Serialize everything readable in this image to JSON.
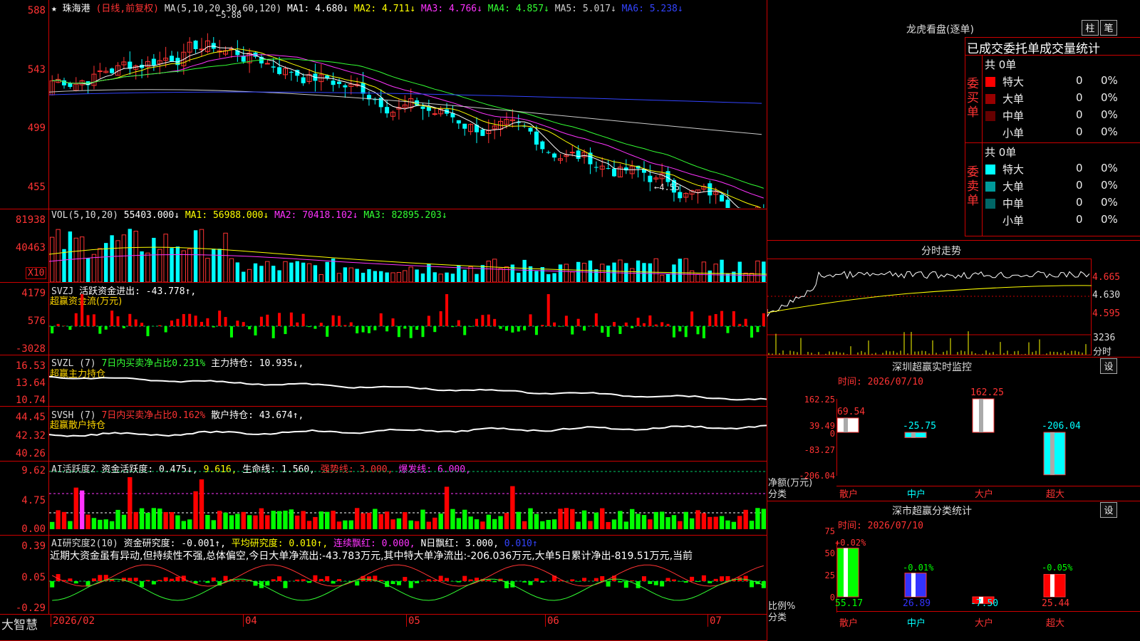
{
  "app_name": "大智慧",
  "main": {
    "star": "★",
    "stock": "珠海港",
    "mode": "(日线,前复权)",
    "ma_legend": [
      {
        "text": "MA(5,10,20,30,60,120)",
        "color": "#dddddd"
      },
      {
        "text": "MA1: 4.680↓",
        "color": "#ffffff"
      },
      {
        "text": "MA2: 4.711↓",
        "color": "#ffff00"
      },
      {
        "text": "MA3: 4.766↓",
        "color": "#ff33ff"
      },
      {
        "text": "MA4: 4.857↓",
        "color": "#33ff33"
      },
      {
        "text": "MA5: 5.017↓",
        "color": "#cccccc"
      },
      {
        "text": "MA6: 5.238↓",
        "color": "#3344ff"
      }
    ],
    "y_ticks": [
      "588",
      "543",
      "499",
      "455"
    ],
    "high_mark": "←5.88",
    "low_mark": "←4.55"
  },
  "vol": {
    "legend": [
      {
        "text": "VOL(5,10,20)",
        "color": "#dddddd"
      },
      {
        "text": "55403.000↓",
        "color": "#ffffff"
      },
      {
        "text": "MA1: 56988.000↓",
        "color": "#ffff00"
      },
      {
        "text": "MA2: 70418.102↓",
        "color": "#ff33ff"
      },
      {
        "text": "MA3: 82895.203↓",
        "color": "#33ff33"
      }
    ],
    "y_ticks": [
      "81938",
      "40463"
    ],
    "unit": "X10"
  },
  "svzj": {
    "legend": [
      {
        "text": "SVZJ",
        "color": "#dddddd"
      },
      {
        "text": "活跃资金进出: -43.778↑,",
        "color": "#ffffff"
      }
    ],
    "subtitle": "超赢资金流(万元)",
    "y_ticks": [
      "4179",
      "576",
      "-3028"
    ]
  },
  "svzl": {
    "legend": [
      {
        "text": "SVZL (7)",
        "color": "#dddddd"
      },
      {
        "text": "7日内买卖净占比0.231%",
        "color": "#33ff33"
      },
      {
        "text": "主力持仓: 10.935↓,",
        "color": "#ffffff"
      }
    ],
    "subtitle": "超赢主力持仓",
    "y_ticks": [
      "16.53",
      "13.64",
      "10.74"
    ]
  },
  "svsh": {
    "legend": [
      {
        "text": "SVSH (7)",
        "color": "#dddddd"
      },
      {
        "text": "7日内买卖净占比0.162%",
        "color": "#ff3333"
      },
      {
        "text": "散户持仓: 43.674↑,",
        "color": "#ffffff"
      }
    ],
    "subtitle": "超赢散户持仓",
    "y_ticks": [
      "44.45",
      "42.32",
      "40.26"
    ]
  },
  "ai_active": {
    "legend": [
      {
        "text": "AI活跃度2",
        "color": "#dddddd"
      },
      {
        "text": "资金活跃度: 0.475↓,",
        "color": "#ffffff"
      },
      {
        "text": "9.616,",
        "color": "#ffff00"
      },
      {
        "text": "生命线: 1.560,",
        "color": "#ffffff"
      },
      {
        "text": "强势线: 3.000,",
        "color": "#ff3333"
      },
      {
        "text": "爆发线: 6.000,",
        "color": "#ff33ff"
      }
    ],
    "y_ticks": [
      "9.62",
      "4.75",
      "0.00"
    ]
  },
  "ai_research": {
    "legend": [
      {
        "text": "AI研究度2(10)",
        "color": "#dddddd"
      },
      {
        "text": "资金研究度: -0.001↑,",
        "color": "#ffffff"
      },
      {
        "text": "平均研究度: 0.010↑,",
        "color": "#ffff00"
      },
      {
        "text": "连续飘红: 0.000,",
        "color": "#ff33ff"
      },
      {
        "text": "N日飘红: 3.000,",
        "color": "#ffffff"
      },
      {
        "text": "0.010↑",
        "color": "#3344ff"
      }
    ],
    "commentary": "近期大资金虽有异动,但持续性不强,总体偏空,今日大单净流出:-43.783万元,其中特大单净流出:-206.036万元,大单5日累计净出-819.51万元,当前",
    "y_ticks": [
      "0.39",
      "0.05",
      "-0.29"
    ]
  },
  "x_axis": [
    "2026/02",
    "04",
    "05",
    "06",
    "07"
  ],
  "dragon": {
    "title": "龙虎看盘(逐单)",
    "btn_bar": "柱",
    "btn_line": "笔",
    "header": "已成交委托单成交量统计",
    "buy_label": "委买单",
    "sell_label": "委卖单",
    "buy_total": "共 0单",
    "sell_total": "共 0单",
    "buy_rows": [
      {
        "name": "特大",
        "qty": "0",
        "pct": "0%",
        "color": "#ff0000"
      },
      {
        "name": "大单",
        "qty": "0",
        "pct": "0%",
        "color": "#990000"
      },
      {
        "name": "中单",
        "qty": "0",
        "pct": "0%",
        "color": "#660000"
      },
      {
        "name": "小单",
        "qty": "0",
        "pct": "0%",
        "color": "#000000"
      }
    ],
    "sell_rows": [
      {
        "name": "特大",
        "qty": "0",
        "pct": "0%",
        "color": "#00ffff"
      },
      {
        "name": "大单",
        "qty": "0",
        "pct": "0%",
        "color": "#009999"
      },
      {
        "name": "中单",
        "qty": "0",
        "pct": "0%",
        "color": "#006666"
      },
      {
        "name": "小单",
        "qty": "0",
        "pct": "0%",
        "color": "#000000"
      }
    ]
  },
  "intraday": {
    "title": "分时走势",
    "right_ticks": [
      "4.665",
      "4.630",
      "4.595"
    ],
    "vol_label": "3236",
    "time_label": "分时"
  },
  "monitor": {
    "title": "深圳超赢实时监控",
    "btn": "设",
    "time": "时间: 2026/07/10",
    "y_ticks": [
      "162.25",
      "39.49",
      "0",
      "-83.27",
      "-206.04"
    ],
    "unit_label": "净额(万元)",
    "class_label": "分类",
    "chart_data": {
      "type": "bar",
      "categories": [
        "散户",
        "中户",
        "大户",
        "超大"
      ],
      "values": [
        69.54,
        -25.75,
        162.25,
        -206.04
      ],
      "ylim": [
        -206.04,
        162.25
      ]
    }
  },
  "classify": {
    "title": "深市超赢分类统计",
    "btn": "设",
    "time": "时间: 2026/07/10",
    "y_ticks": [
      "75",
      "50",
      "25",
      "0"
    ],
    "unit_label": "比例%",
    "class_label": "分类",
    "chart_data": {
      "type": "bar",
      "categories": [
        "散户",
        "中户",
        "大户",
        "超大"
      ],
      "values": [
        55.17,
        26.89,
        -7.5,
        25.44
      ],
      "changes": [
        "+0.02%",
        "-0.01%",
        "",
        "-0.05%"
      ],
      "ylim": [
        0,
        75
      ]
    }
  }
}
